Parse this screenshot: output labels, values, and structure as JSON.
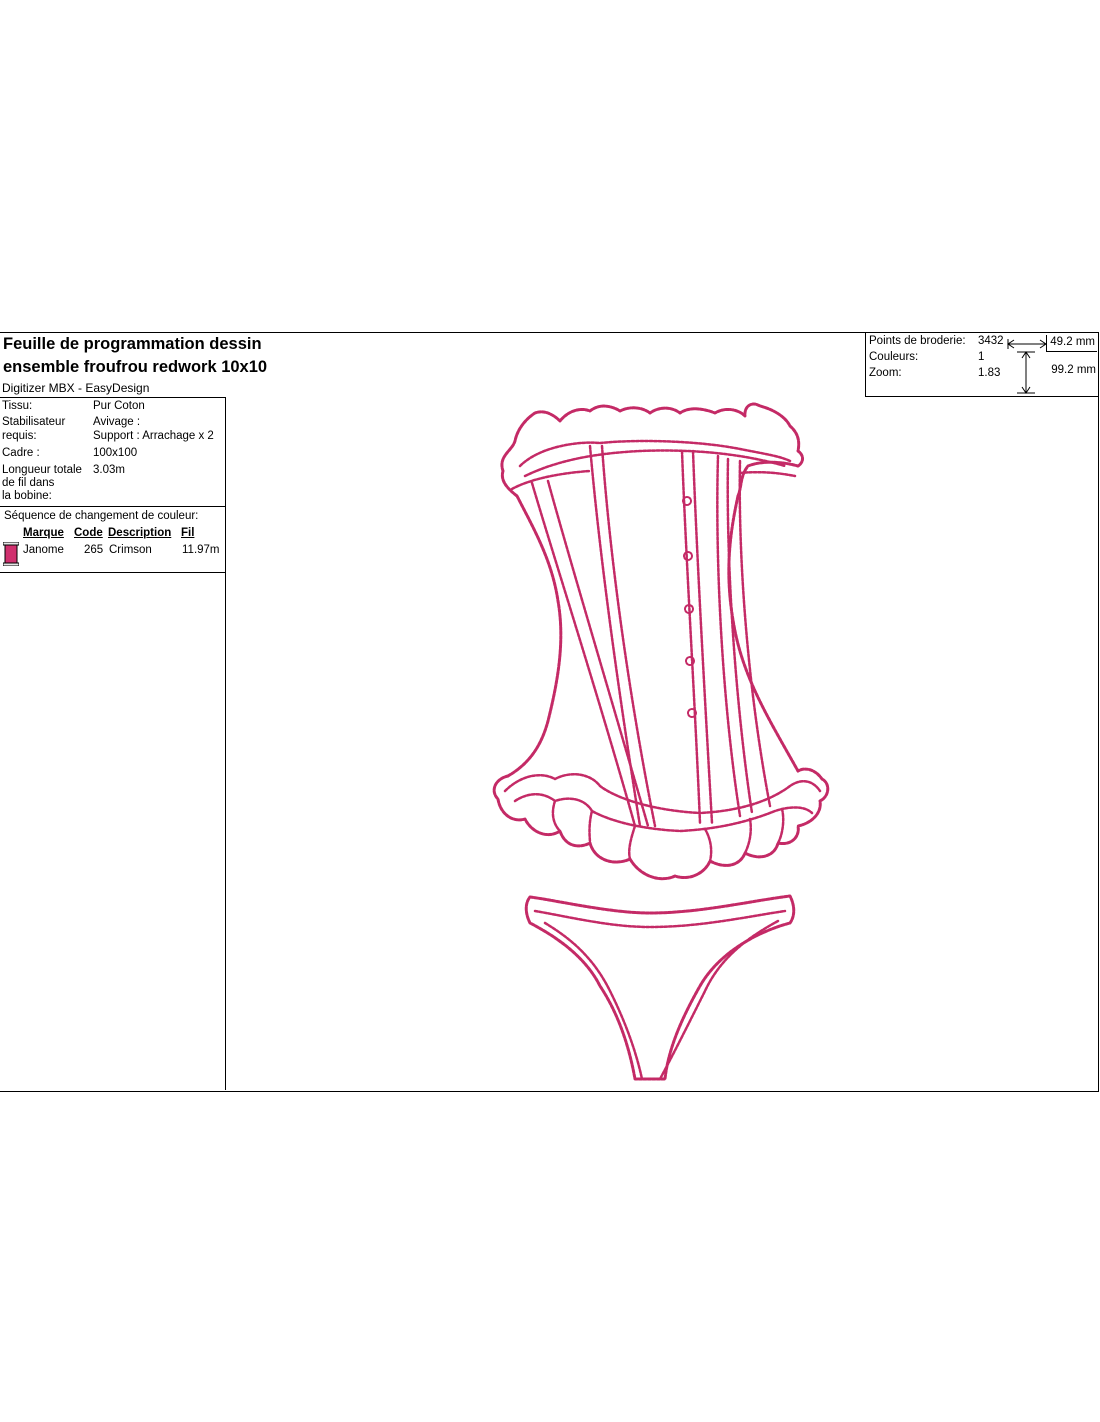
{
  "header": {
    "title_line1": "Feuille de programmation dessin",
    "title_line2": "ensemble froufrou redwork 10x10",
    "software": "Digitizer MBX - EasyDesign"
  },
  "stats": {
    "stitches_label": "Points de broderie:",
    "stitches_value": "3432",
    "colors_label": "Couleurs:",
    "colors_value": "1",
    "zoom_label": "Zoom:",
    "zoom_value": "1.83",
    "width": "49.2 mm",
    "height": "99.2 mm"
  },
  "info": {
    "fabric_label": "Tissu:",
    "fabric_value": "Pur Coton",
    "stabilizer_label_1": "Stabilisateur",
    "stabilizer_label_2": "requis:",
    "stabilizer_value_1": "Avivage :",
    "stabilizer_value_2": "Support : Arrachage x 2",
    "frame_label": "Cadre :",
    "frame_value": "100x100",
    "bobbin_label_1": "Longueur totale",
    "bobbin_label_2": "de fil dans",
    "bobbin_label_3": "la bobine:",
    "bobbin_value": "3.03m"
  },
  "color_sequence": {
    "title": "Séquence de changement de couleur:",
    "headers": {
      "brand": "Marque",
      "code": "Code",
      "description": "Description",
      "thread": "Fil"
    },
    "rows": [
      {
        "brand": "Janome",
        "code": "265",
        "description": "Crimson",
        "thread": "11.97m",
        "swatch": "#d0306e"
      }
    ]
  },
  "colors": {
    "thread": "#c42a66",
    "thread_dark": "#7a1f3f"
  },
  "icons": {
    "spool": "thread-spool-icon",
    "width_arrow": "horizontal-dimension-arrow-icon",
    "height_arrow": "vertical-dimension-arrow-icon"
  }
}
